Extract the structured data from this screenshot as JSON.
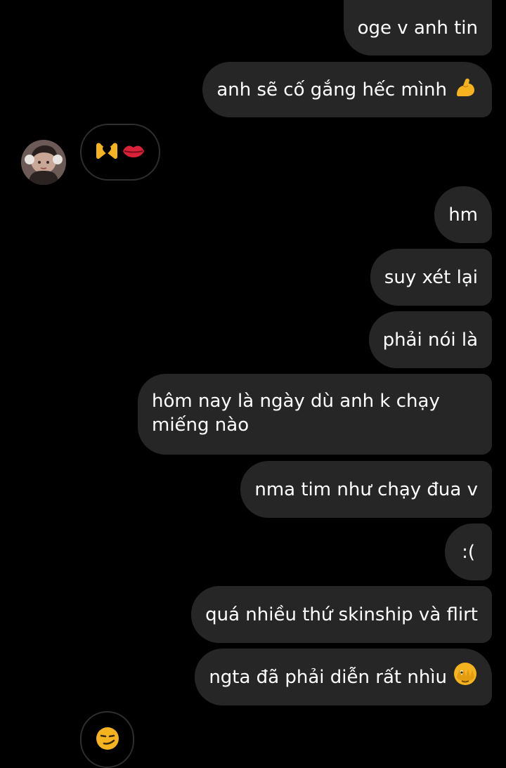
{
  "conversation": {
    "messages": [
      {
        "text": "oge v anh tin"
      },
      {
        "text": "anh sẽ cố gắng hếc mình",
        "emoji": "flexed-biceps"
      },
      {
        "text": "hm"
      },
      {
        "text": "suy xét lại"
      },
      {
        "text": "phải nói là"
      },
      {
        "text": "hôm nay là ngày dù anh k chạy",
        "text2": "miếng nào"
      },
      {
        "text": "nma tim như chạy đua v"
      },
      {
        "text": ":("
      },
      {
        "text": "quá nhiều thứ skinship và flirt"
      },
      {
        "text": "ngta đã phải diễn rất nhìu",
        "emoji": "face-with-peeking-eye"
      }
    ],
    "incoming": [
      {
        "emojis": [
          "heart-hands",
          "kiss-mark"
        ]
      },
      {
        "emojis": [
          "smirking-face"
        ]
      }
    ]
  },
  "colors": {
    "background": "#000000",
    "outgoing_bubble": "#262626",
    "incoming_border": "#2e2e2e",
    "text": "#ffffff",
    "emoji_yellow": "#f5b41f",
    "kiss_red": "#d9213a"
  }
}
